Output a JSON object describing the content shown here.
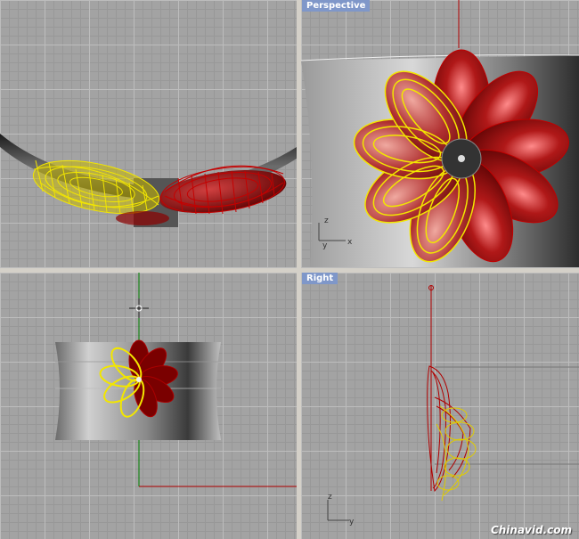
{
  "viewports": {
    "top": {
      "label": ""
    },
    "perspective": {
      "label": "Perspective"
    },
    "front": {
      "label": ""
    },
    "right": {
      "label": "Right"
    }
  },
  "axes": {
    "persp": {
      "z": "z",
      "y": "y",
      "x": "x"
    },
    "right": {
      "z": "z",
      "y": "y"
    }
  },
  "colors": {
    "selected_wire": "#f2e600",
    "red_surface": "#8c0000",
    "grid_bg": "#a3a3a3",
    "x_axis": "#b00000",
    "y_axis": "#008000",
    "label_bg": "#7f97c9"
  },
  "watermark": "Chinavid.com"
}
